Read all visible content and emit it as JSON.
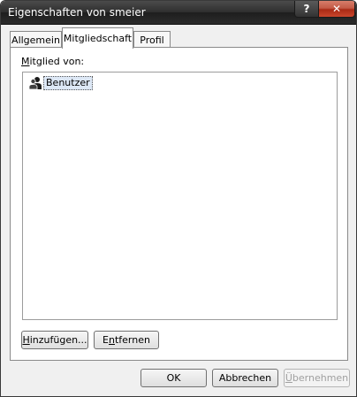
{
  "window": {
    "title": "Eigenschaften von smeier",
    "help_label": "?",
    "close_label": "✕"
  },
  "tabs": [
    {
      "label": "Allgemein"
    },
    {
      "label": "Mitgliedschaft"
    },
    {
      "label": "Profil"
    }
  ],
  "membership": {
    "label_accel": "M",
    "label_rest": "itglied von:",
    "items": [
      {
        "label": "Benutzer",
        "icon": "user-group-icon"
      }
    ],
    "add_accel": "H",
    "add_rest": "inzufügen...",
    "remove_pre": "E",
    "remove_accel": "n",
    "remove_rest": "tfernen"
  },
  "footer": {
    "ok_label": "OK",
    "cancel_label": "Abbrechen",
    "apply_accel": "Ü",
    "apply_rest": "bernehmen"
  }
}
